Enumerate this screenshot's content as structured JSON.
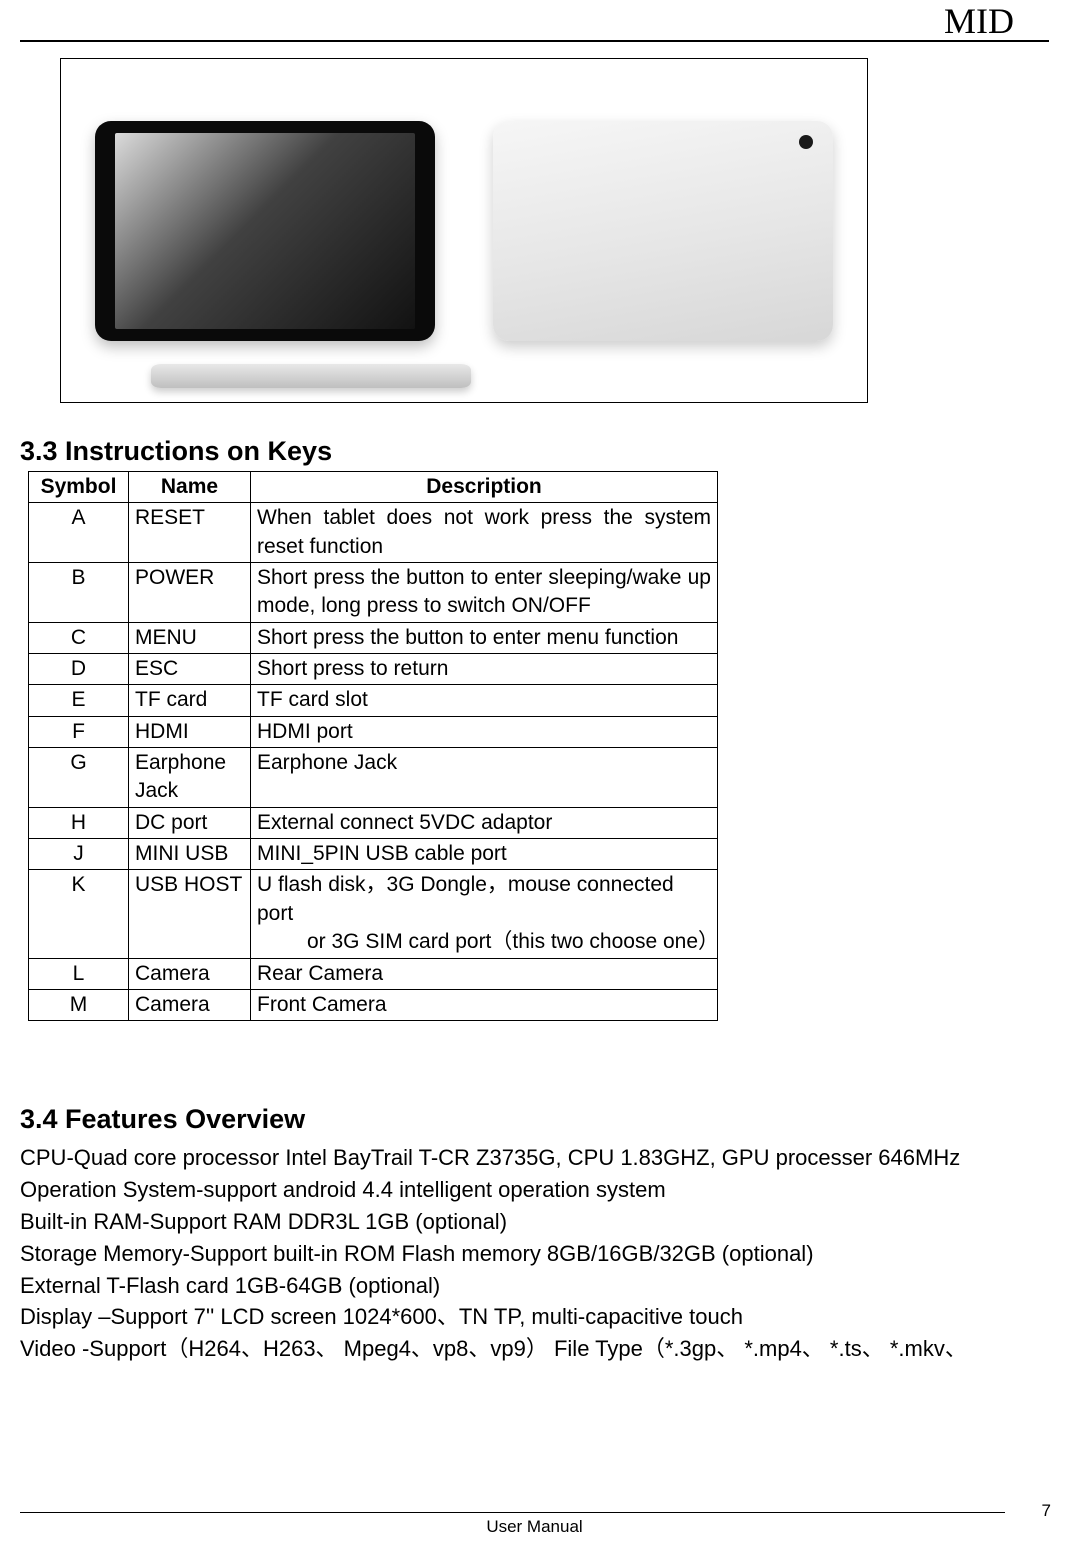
{
  "header": {
    "title": "MID"
  },
  "sections": {
    "keys_heading": "3.3 Instructions on Keys",
    "features_heading": "3.4 Features Overview"
  },
  "keys_table": {
    "headers": {
      "symbol": "Symbol",
      "name": "Name",
      "description": "Description"
    },
    "rows": [
      {
        "symbol": "A",
        "name": "RESET",
        "description": "When tablet does not work press the system reset function",
        "justify": true
      },
      {
        "symbol": "B",
        "name": "POWER",
        "description": "Short press the button to enter sleeping/wake up mode, long press to switch ON/OFF",
        "justify": true
      },
      {
        "symbol": "C",
        "name": "MENU",
        "description": "Short press the button to enter menu function"
      },
      {
        "symbol": "D",
        "name": "ESC",
        "description": "Short press to return"
      },
      {
        "symbol": "E",
        "name": "TF card",
        "description": "TF card slot"
      },
      {
        "symbol": "F",
        "name": "HDMI",
        "description": "HDMI port"
      },
      {
        "symbol": "G",
        "name": "Earphone Jack",
        "description": "Earphone Jack"
      },
      {
        "symbol": "H",
        "name": "DC port",
        "description": "External connect 5VDC adaptor"
      },
      {
        "symbol": "J",
        "name": "MINI USB",
        "description": "MINI_5PIN USB cable port"
      },
      {
        "symbol": "K",
        "name": "USB HOST",
        "description": "U flash disk，3G Dongle，mouse connected port",
        "line2": "or 3G SIM card port（this two choose one）"
      },
      {
        "symbol": "L",
        "name": "Camera",
        "description": "Rear Camera"
      },
      {
        "symbol": "M",
        "name": "Camera",
        "description": "Front Camera"
      }
    ]
  },
  "features": {
    "lines": [
      "CPU-Quad core processor Intel BayTrail T-CR Z3735G, CPU 1.83GHZ, GPU processer 646MHz",
      "Operation System-support android 4.4 intelligent operation system",
      "Built-in RAM-Support RAM DDR3L 1GB (optional)",
      "Storage Memory-Support built-in ROM Flash memory 8GB/16GB/32GB (optional)",
      "External T-Flash card 1GB-64GB (optional)",
      "Display –Support 7'' LCD screen 1024*600、TN TP, multi-capacitive touch",
      "Video -Support（H264、H263、 Mpeg4、vp8、vp9） File Type（*.3gp、 *.mp4、 *.ts、 *.mkv、"
    ]
  },
  "footer": {
    "center": "User Manual",
    "page": "7"
  }
}
